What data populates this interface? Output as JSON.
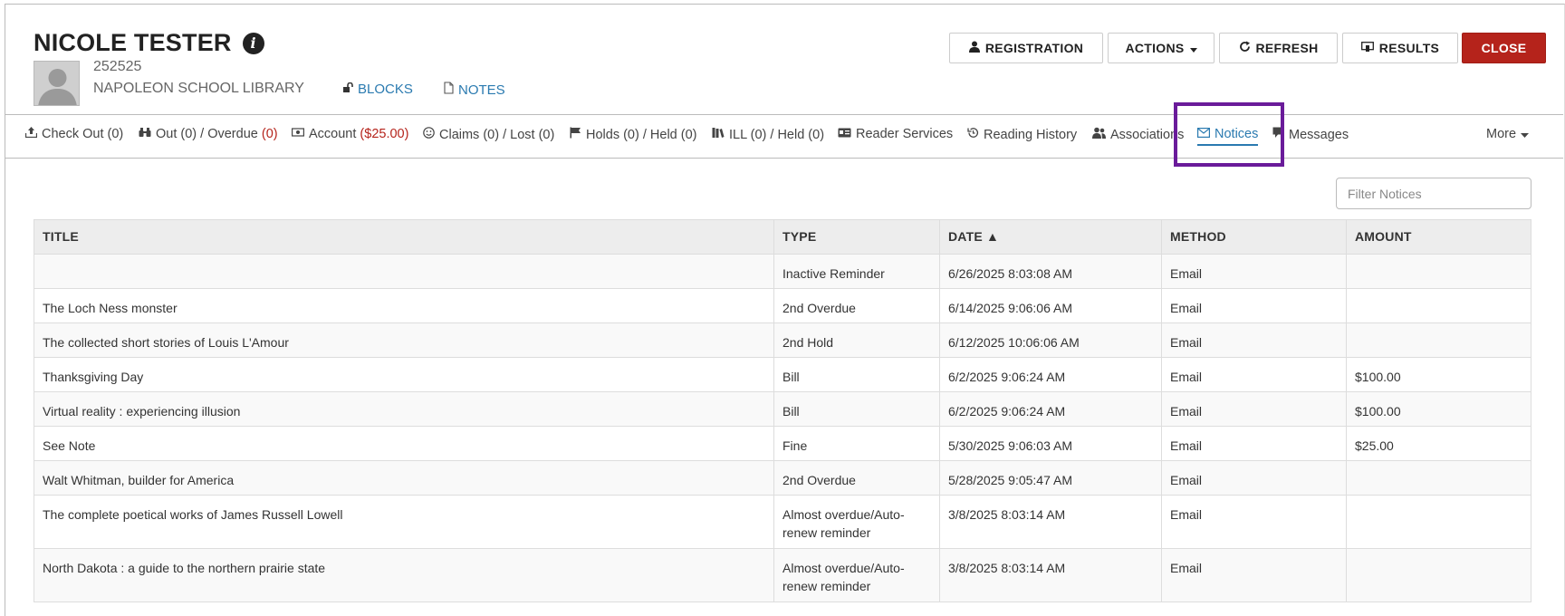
{
  "patron": {
    "name": "NICOLE TESTER",
    "barcode": "252525",
    "library": "NAPOLEON SCHOOL LIBRARY",
    "blocks_label": "BLOCKS",
    "notes_label": "NOTES"
  },
  "toolbar": {
    "registration": "REGISTRATION",
    "actions": "ACTIONS",
    "refresh": "REFRESH",
    "results": "RESULTS",
    "close": "CLOSE"
  },
  "nav": {
    "checkout": "Check Out (0)",
    "out_prefix": "Out (0) / Overdue ",
    "out_overdue": "(0)",
    "account_prefix": "Account ",
    "account_amount": "($25.00)",
    "claims": "Claims (0) / Lost (0)",
    "holds": "Holds (0) / Held (0)",
    "ill": "ILL (0) / Held (0)",
    "reader_services": "Reader Services",
    "reading_history": "Reading History",
    "associations": "Associations",
    "notices": "Notices",
    "messages": "Messages",
    "more": "More"
  },
  "filter": {
    "placeholder": "Filter Notices"
  },
  "table": {
    "headers": [
      "TITLE",
      "TYPE",
      "DATE ▲",
      "METHOD",
      "AMOUNT"
    ],
    "rows": [
      [
        "",
        "Inactive Reminder",
        "6/26/2025 8:03:08 AM",
        "Email",
        ""
      ],
      [
        "The Loch Ness monster",
        "2nd Overdue",
        "6/14/2025 9:06:06 AM",
        "Email",
        ""
      ],
      [
        "The collected short stories of Louis L'Amour",
        "2nd Hold",
        "6/12/2025 10:06:06 AM",
        "Email",
        ""
      ],
      [
        "Thanksgiving Day",
        "Bill",
        "6/2/2025 9:06:24 AM",
        "Email",
        "$100.00"
      ],
      [
        "Virtual reality : experiencing illusion",
        "Bill",
        "6/2/2025 9:06:24 AM",
        "Email",
        "$100.00"
      ],
      [
        "See Note",
        "Fine",
        "5/30/2025 9:06:03 AM",
        "Email",
        "$25.00"
      ],
      [
        "Walt Whitman, builder for America",
        "2nd Overdue",
        "5/28/2025 9:05:47 AM",
        "Email",
        ""
      ],
      [
        "The complete poetical works of James Russell Lowell",
        "Almost overdue/Auto-renew reminder",
        "3/8/2025 8:03:14 AM",
        "Email",
        ""
      ],
      [
        "North Dakota : a guide to the northern prairie state",
        "Almost overdue/Auto-renew reminder",
        "3/8/2025 8:03:14 AM",
        "Email",
        ""
      ]
    ]
  },
  "colors": {
    "accent": "#2a7ab0",
    "danger": "#b5231b",
    "highlight": "#6a1b9a"
  }
}
